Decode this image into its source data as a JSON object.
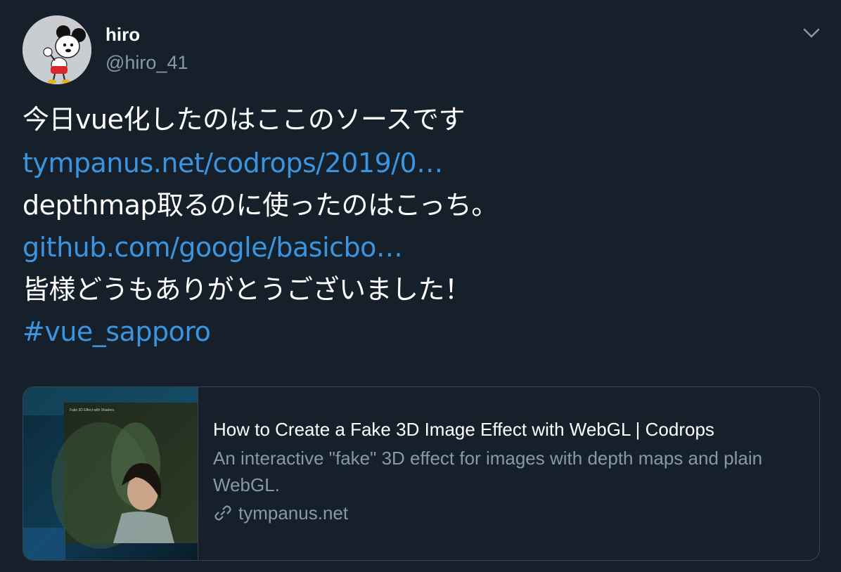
{
  "author": {
    "display_name": "hiro",
    "handle": "@hiro_41"
  },
  "tweet": {
    "line1": "今日vue化したのはここのソースです",
    "link1": "tympanus.net/codrops/2019/0…",
    "line3": "depthmap取るのに使ったのはこっち。",
    "link2": "github.com/google/basicbo…",
    "line5": "皆様どうもありがとうございました！",
    "hashtag": "#vue_sapporo"
  },
  "card": {
    "title": "How to Create a Fake 3D Image Effect with WebGL | Codrops",
    "description": "An interactive \"fake\" 3D effect for images with depth maps and plain WebGL.",
    "domain": "tympanus.net",
    "domain_icon": "link-icon"
  },
  "icons": {
    "menu": "chevron-down-icon"
  },
  "colors": {
    "background": "#15202b",
    "link": "#3a94e0",
    "secondary_text": "#8899a6",
    "border": "#38444d"
  }
}
